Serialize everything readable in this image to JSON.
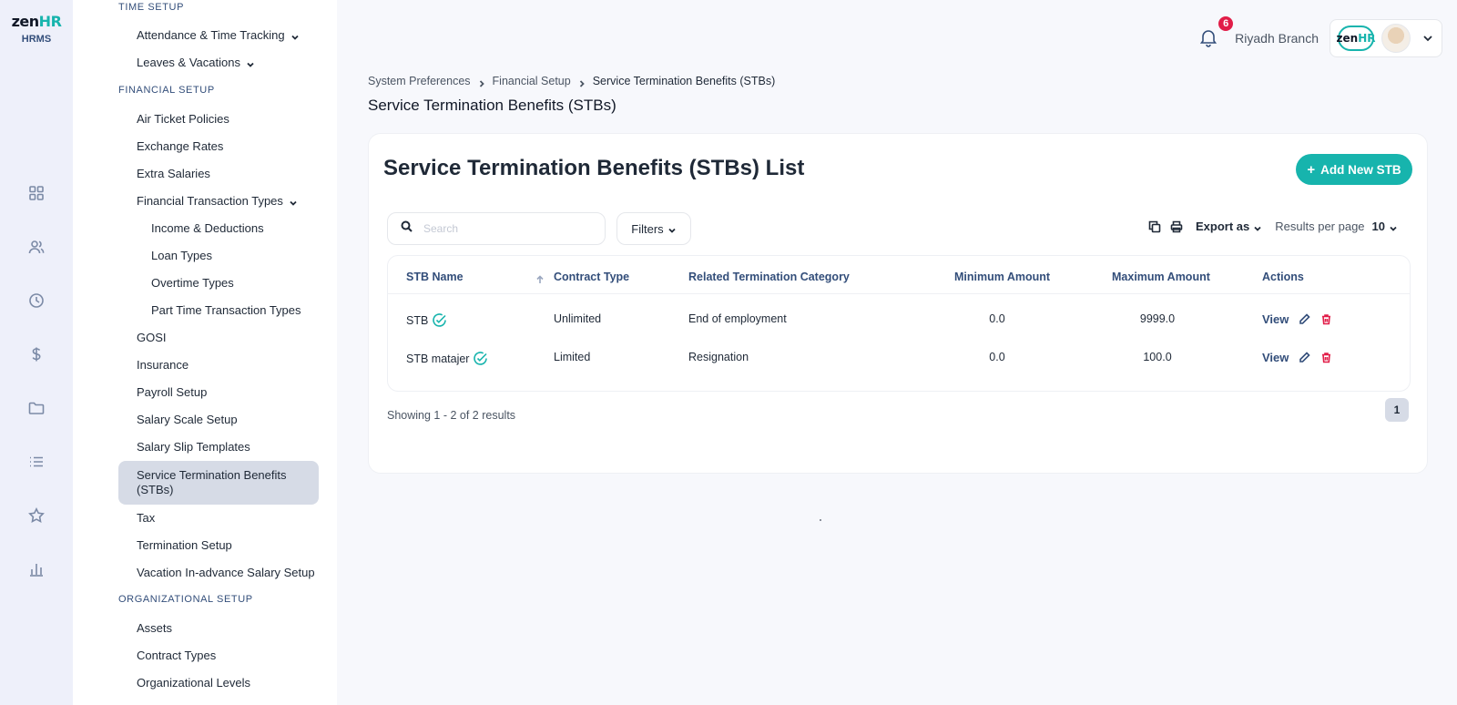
{
  "logo": {
    "brand_main": "zen",
    "brand_accent": "HR",
    "subtitle": "HRMS"
  },
  "rail_icons": [
    "grid-icon",
    "users-icon",
    "clock-icon",
    "dollar-icon",
    "folder-icon",
    "list-icon",
    "star-icon",
    "bar-chart-icon"
  ],
  "menu": {
    "time_setup": "TIME SETUP",
    "attendance": "Attendance & Time Tracking",
    "leaves": "Leaves & Vacations",
    "financial_setup": "FINANCIAL SETUP",
    "air_ticket": "Air Ticket Policies",
    "exchange_rates": "Exchange Rates",
    "extra_salaries": "Extra Salaries",
    "fin_trans_types": "Financial Transaction Types",
    "income_deductions": "Income & Deductions",
    "loan_types": "Loan Types",
    "overtime_types": "Overtime Types",
    "part_time": "Part Time Transaction Types",
    "gosi": "GOSI",
    "insurance": "Insurance",
    "payroll_setup": "Payroll Setup",
    "salary_scale": "Salary Scale Setup",
    "salary_slip": "Salary Slip Templates",
    "stb": "Service Termination Benefits (STBs)",
    "tax": "Tax",
    "termination_setup": "Termination Setup",
    "vacation_advance": "Vacation In-advance Salary Setup",
    "org_setup": "ORGANIZATIONAL SETUP",
    "assets": "Assets",
    "contract_types": "Contract Types",
    "org_levels": "Organizational Levels"
  },
  "header": {
    "notification_count": "6",
    "branch": "Riyadh Branch",
    "mini_logo_main": "zen",
    "mini_logo_accent": "HR"
  },
  "breadcrumb": {
    "items": [
      "System Preferences",
      "Financial Setup",
      "Service Termination Benefits (STBs)"
    ]
  },
  "page_title": "Service Termination Benefits (STBs)",
  "card": {
    "title": "Service Termination Benefits (STBs) List",
    "add_button": "Add New STB",
    "search_placeholder": "Search",
    "filters": "Filters",
    "export": "Export as",
    "results_per_page_label": "Results per page",
    "results_per_page_value": "10"
  },
  "table": {
    "columns": [
      "STB Name",
      "Contract Type",
      "Related Termination Category",
      "Minimum Amount",
      "Maximum Amount",
      "Actions"
    ],
    "rows": [
      {
        "name": "STB",
        "contract": "Unlimited",
        "category": "End of employment",
        "min": "0.0",
        "max": "9999.0",
        "action": "View"
      },
      {
        "name": "STB matajer",
        "contract": "Limited",
        "category": "Resignation",
        "min": "0.0",
        "max": "100.0",
        "action": "View"
      }
    ]
  },
  "footer": {
    "showing": "Showing 1 - 2 of 2 results",
    "page": "1"
  },
  "colors": {
    "accent": "#17b4ad",
    "badge": "#e11d48",
    "delete": "#e11d48",
    "nav_text": "#334e7a"
  }
}
